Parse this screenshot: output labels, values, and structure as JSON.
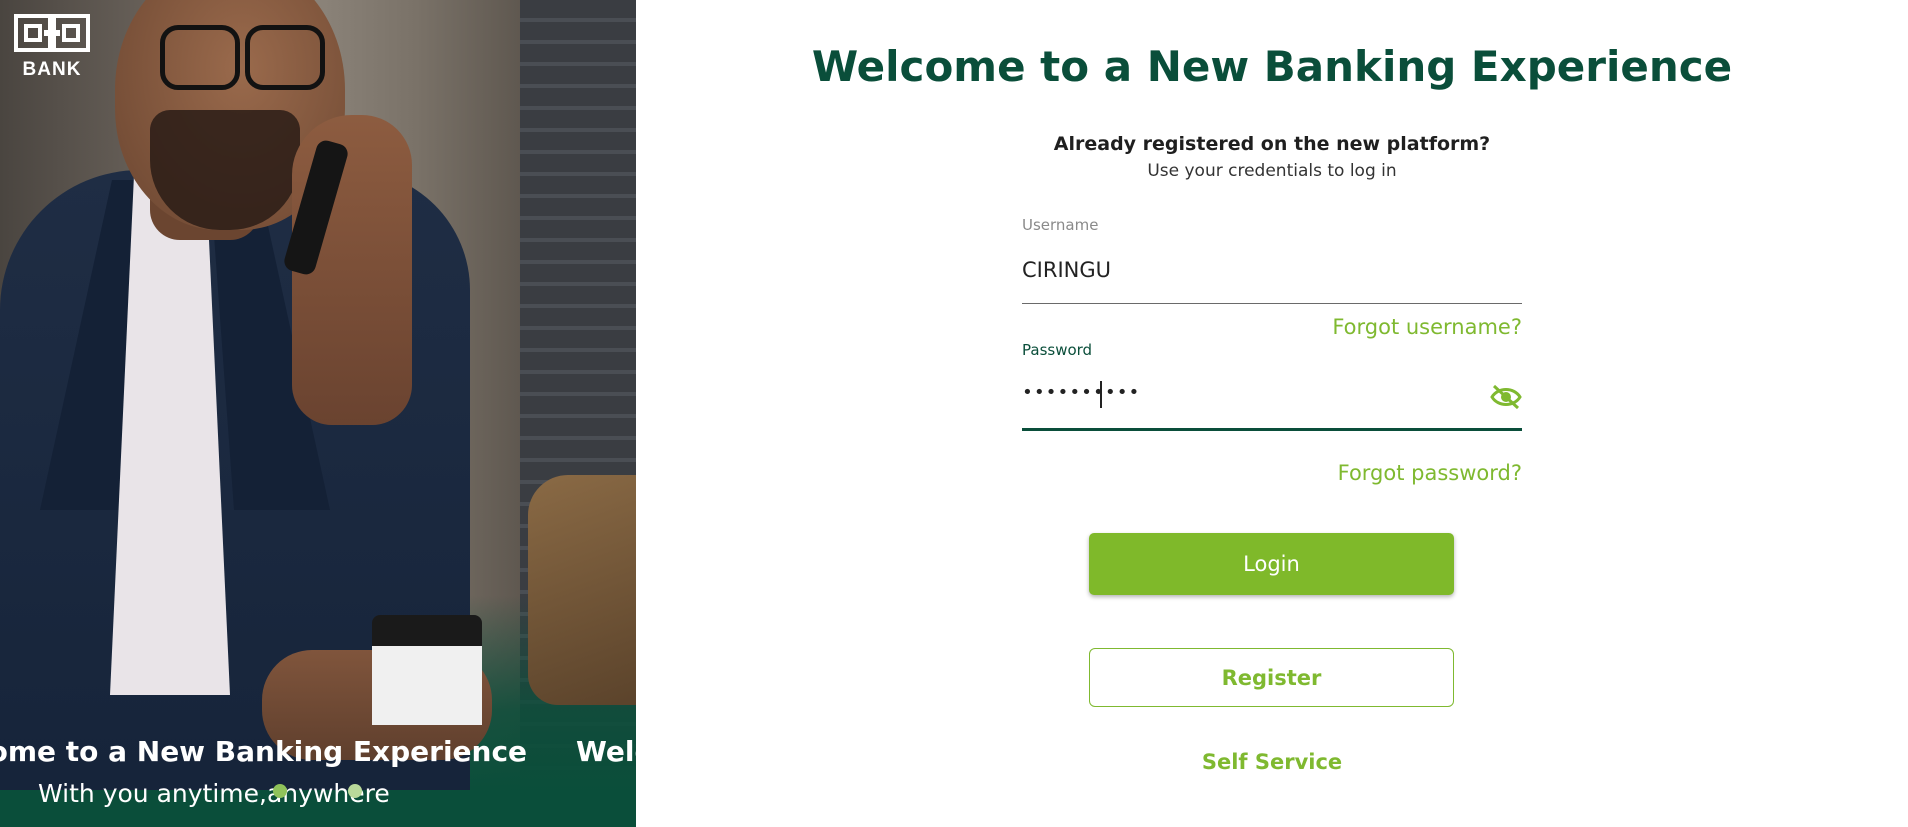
{
  "brand": {
    "logo_text": "BANK",
    "primary_color": "#0a4e3a",
    "accent_color": "#7fb930"
  },
  "hero": {
    "slide1_title": "come to a New Banking Experience",
    "slide2_title": "Welc",
    "subtitle": "With you anytime,anywhere"
  },
  "main": {
    "title": "Welcome to a New Banking Experience",
    "already_registered": "Already registered on the new platform?",
    "use_credentials": "Use your credentials to log in"
  },
  "form": {
    "username_label": "Username",
    "username_value": "CIRINGU",
    "forgot_username": "Forgot username?",
    "password_label": "Password",
    "password_masked": "••••••••••",
    "password_toggle_icon": "eye-off-icon",
    "forgot_password": "Forgot password?",
    "login_label": "Login",
    "register_label": "Register",
    "self_service_label": "Self Service"
  }
}
